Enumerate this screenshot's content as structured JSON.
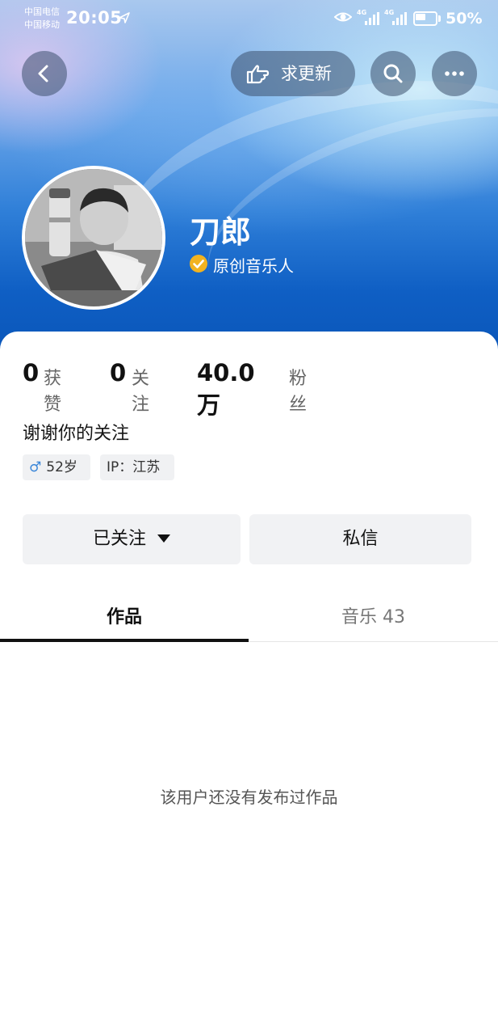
{
  "status_bar": {
    "carrier_1": "中国电信",
    "carrier_2": "中国移动",
    "time": "20:05",
    "signal_1_label": "4G",
    "signal_2_label": "4G",
    "battery": "50%"
  },
  "top_nav": {
    "update_label": "求更新"
  },
  "profile": {
    "name": "刀郎",
    "verified_label": "原创音乐人",
    "verified_color": "#f2b320"
  },
  "stats": {
    "likes_value": "0",
    "likes_label": "获赞",
    "following_value": "0",
    "following_label": "关注",
    "followers_value": "40.0万",
    "followers_label": "粉丝"
  },
  "bio": "谢谢你的关注",
  "tags": {
    "gender_symbol": "♂",
    "age": "52岁",
    "ip": "IP：江苏"
  },
  "actions": {
    "follow_label": "已关注",
    "message_label": "私信"
  },
  "tabs": [
    {
      "label": "作品",
      "active": true
    },
    {
      "label": "音乐 43",
      "active": false
    }
  ],
  "empty_state": "该用户还没有发布过作品"
}
